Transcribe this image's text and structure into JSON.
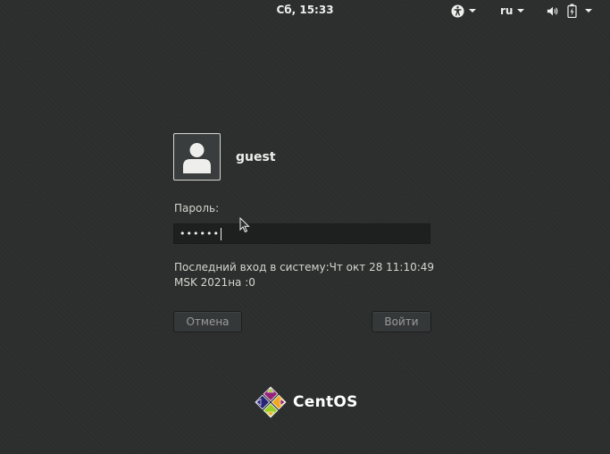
{
  "topbar": {
    "clock": "Сб, 15:33",
    "accessibility_icon": "accessibility-icon",
    "keyboard_layout": "ru",
    "volume_icon": "volume-icon",
    "battery_icon": "battery-icon",
    "menu_caret_icon": "chevron-down-icon"
  },
  "user": {
    "avatar_icon": "user-avatar-icon",
    "name": "guest"
  },
  "password": {
    "label": "Пароль:",
    "masked_value": "••••••"
  },
  "last_login": "Последний вход в систему:Чт окт 28 11:10:49 MSK 2021на :0",
  "buttons": {
    "cancel": "Отмена",
    "login": "Войти"
  },
  "logo": {
    "text": "CentOS",
    "icon": "centos-logo-icon"
  },
  "colors": {
    "background": "#2c2e2e",
    "text": "#eeeeec",
    "button_text": "#9a9c9a",
    "logo_purple": "#932279",
    "logo_yellow": "#efa724",
    "logo_green": "#9ccd2a",
    "logo_blue": "#262577"
  }
}
